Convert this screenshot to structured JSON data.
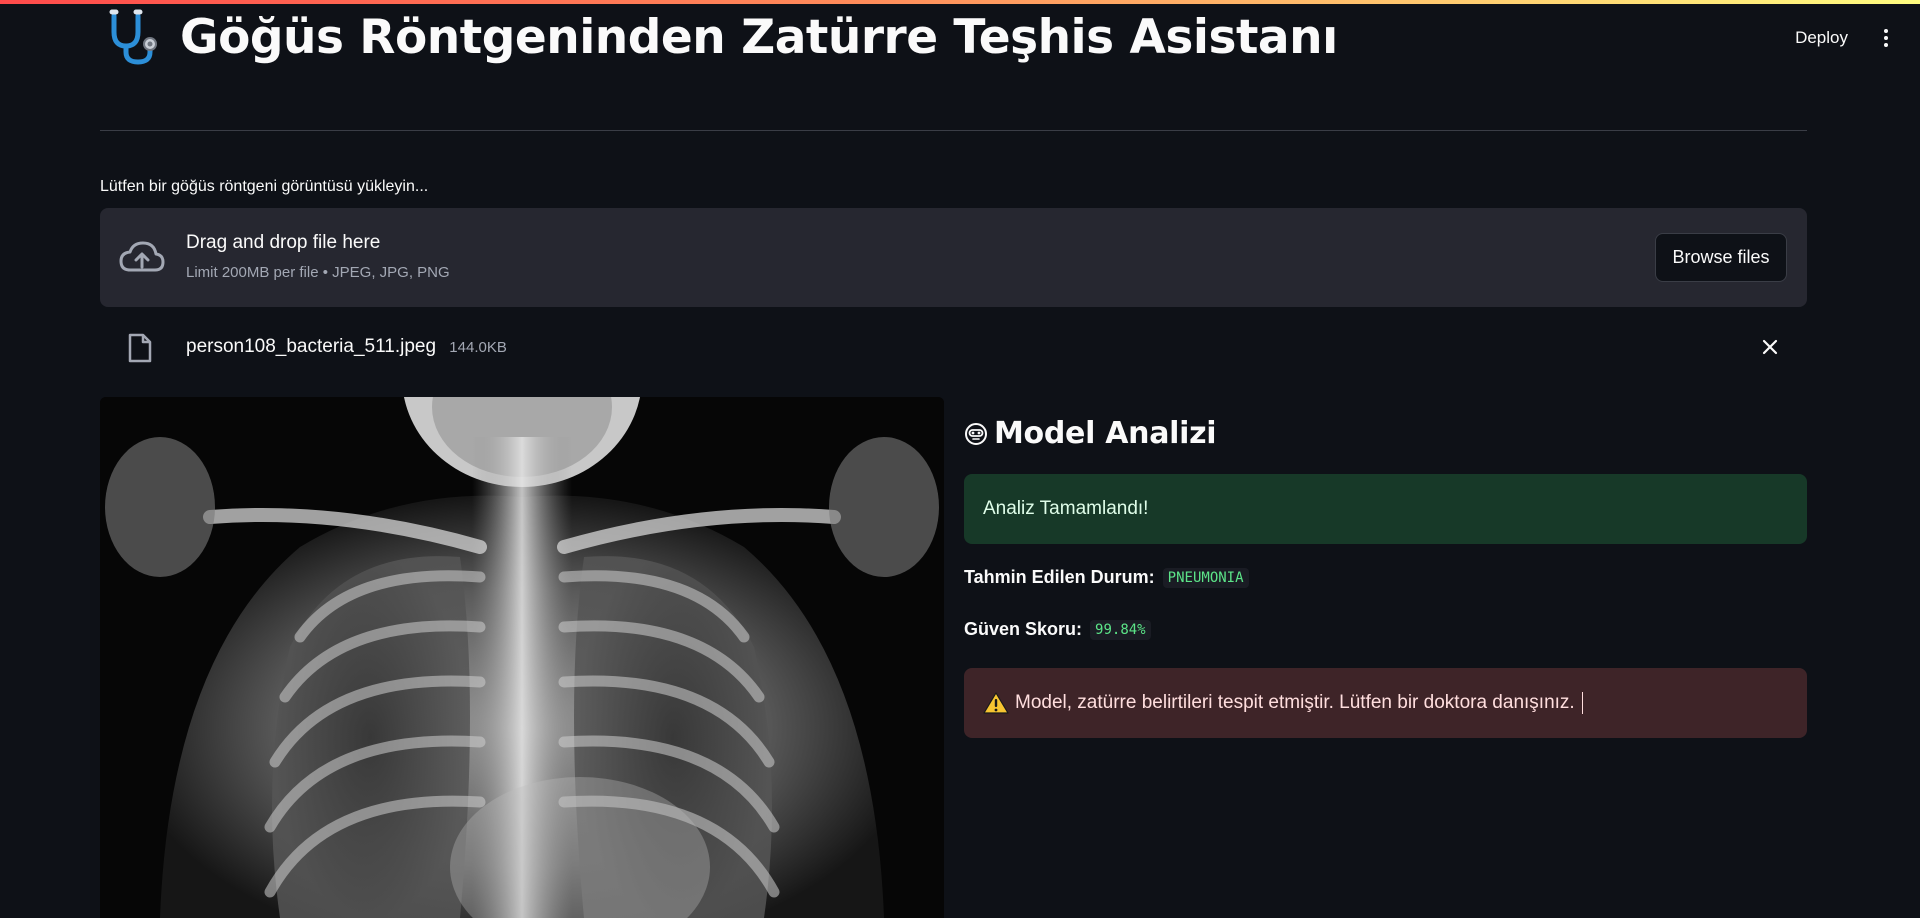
{
  "app": {
    "title": "Göğüs Röntgeninden Zatürre Teşhis Asistanı",
    "deploy_label": "Deploy",
    "accent_gradient": [
      "#ff4b4b",
      "#fffd80"
    ]
  },
  "uploader": {
    "label": "Lütfen bir göğüs röntgeni görüntüsü yükleyin...",
    "drop_title": "Drag and drop file here",
    "drop_subtitle": "Limit 200MB per file • JPEG, JPG, PNG",
    "browse_label": "Browse files",
    "icon": "cloud-upload-icon"
  },
  "file": {
    "name": "person108_bacteria_511.jpeg",
    "size": "144.0KB",
    "icon": "file-icon"
  },
  "analysis": {
    "title": "Model Analizi",
    "title_icon": "robot-icon",
    "success_message": "Analiz Tamamlandı!",
    "prediction_label": "Tahmin Edilen Durum:",
    "prediction_value": "PNEUMONIA",
    "confidence_label": "Güven Skoru:",
    "confidence_value": "99.84%",
    "warning_icon": "warning-icon",
    "warning_message": "Model, zatürre belirtileri tespit etmiştir. Lütfen bir doktora danışınız.",
    "colors": {
      "success_bg": "#173928",
      "error_bg": "#3e2428",
      "code_text": "#5ce488"
    }
  }
}
